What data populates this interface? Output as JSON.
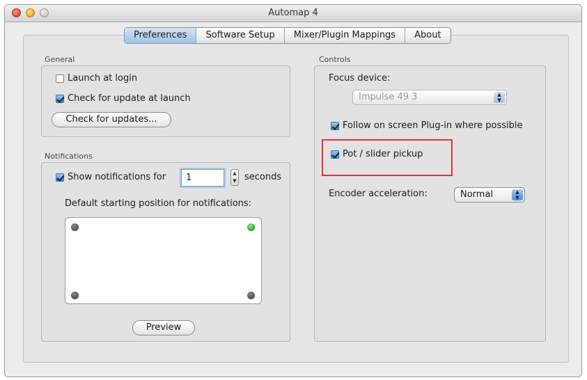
{
  "window": {
    "title": "Automap 4"
  },
  "tabs": [
    {
      "label": "Preferences",
      "active": true
    },
    {
      "label": "Software Setup",
      "active": false
    },
    {
      "label": "Mixer/Plugin Mappings",
      "active": false
    },
    {
      "label": "About",
      "active": false
    }
  ],
  "general": {
    "section_label": "General",
    "launch_at_login": {
      "label": "Launch at login",
      "checked": false
    },
    "check_update_launch": {
      "label": "Check for update at launch",
      "checked": true
    },
    "check_updates_button": "Check for updates..."
  },
  "notifications": {
    "section_label": "Notifications",
    "show_notifications": {
      "label": "Show notifications for",
      "checked": true
    },
    "seconds_value": "1",
    "seconds_label": "seconds",
    "position_label": "Default starting position for notifications:",
    "selected_position": "top-right",
    "preview_button": "Preview"
  },
  "controls": {
    "section_label": "Controls",
    "focus_device_label": "Focus device:",
    "focus_device_value": "Impulse 49  3",
    "follow_plugin": {
      "label": "Follow on screen Plug-in where possible",
      "checked": true
    },
    "pot_pickup": {
      "label": "Pot / slider pickup",
      "checked": true
    },
    "encoder_label": "Encoder acceleration:",
    "encoder_value": "Normal"
  },
  "colors": {
    "highlight": "#e0343a",
    "accent": "#3f86d6",
    "active_dot": "#1fa31f"
  }
}
